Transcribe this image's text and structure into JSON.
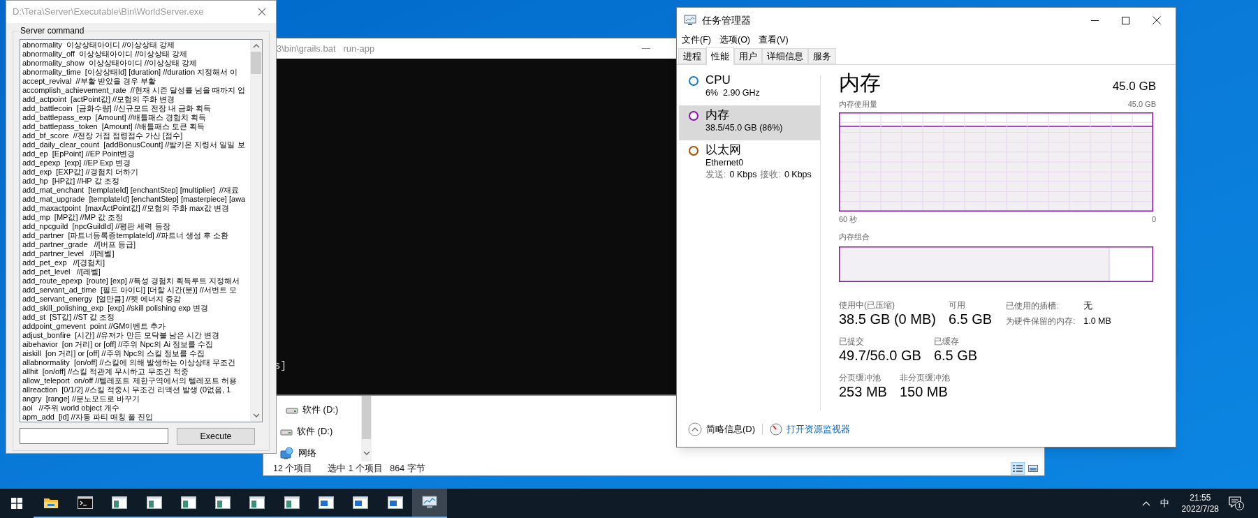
{
  "server_window": {
    "title": "D:\\Tera\\Server\\Executable\\Bin\\WorldServer.exe",
    "group_label": "Server command",
    "commands": [
      "abnormality  이상상태아이디 //이상상태 강제",
      "abnormality_off  이상상태아이디 //이상상태 강제",
      "abnormality_show  이상상태아이디 //이상상태 강제",
      "abnormality_time  [이상상태Id] [duration] //duration 지정해서 이",
      "accept_revival  //부활 받았을 경우 부활",
      "accomplish_achievement_rate  //현재 시즌 달성률 넘을 때까지 업",
      "add_actpoint  [actPoint값] //모험의 주화 변경",
      "add_battlecoin  [금화수량] //신규모드 전장 내 금화 획득",
      "add_battlepass_exp  [Amount] //배틀패스 경험치 획득",
      "add_battlepass_token  [Amount] //배틀패스 토큰 획득",
      "add_bf_score  //전장 거점 점령점수 가산 [점수]",
      "add_daily_clear_count  [addBonusCount] //발키온 지령서 일일 보",
      "add_ep  [EpPoint] //EP Point변경",
      "add_epexp  [exp] //EP Exp 변경",
      "add_exp  [EXP값] //경험치 더하기",
      "add_hp  [HP값] //HP 값 조정",
      "add_mat_enchant  [templateId] [enchantStep] [multiplier]  //재료",
      "add_mat_upgrade  [templateId] [enchantStep] [masterpiece] [awa",
      "add_maxactpoint  [maxActPoint값] //모험의 주화 max값 변경",
      "add_mp  [MP값] //MP 값 조정",
      "add_npcguild  [npcGuildId] //평판 세력 등장",
      "add_partner  [파트너등록증templateId] //파트너 생성 후 소환",
      "add_partner_grade   //[버프 등급]",
      "add_partner_level   //[레벨]",
      "add_pet_exp   //[경험치]",
      "add_pet_level   //[레벨]",
      "add_route_epexp  [route] [exp] //특성 경험치 획득루트 지정해서",
      "add_servant_ad_time  [필드 아이디] [더할 시간(분)] //서번트 모",
      "add_servant_energy  [얼만큼] //펫 에너지 증감",
      "add_skill_polishing_exp  [exp] //skill polishing exp 변경",
      "add_st  [ST값] //ST 값 조정",
      "addpoint_gmevent  point //GM이벤트 추가",
      "adjust_bonfire  [시간] //유저가 만든 모닥불 남은 시간 변경",
      "aibehavior  [on 거리] or [off] //주위 Npc의 Ai 정보를 수집",
      "aiskill  [on 거리] or [off] //주위 Npc의 스킬 정보를 수집",
      "allabnormality  [on/off] //스킬에 의해 발생하는 이상상태 무조건",
      "allhit  [on/off] //스킬 적관계 무시하고 무조건 적중",
      "allow_teleport  on/off //텔레포트 제한구역에서의 텔레포트 허용",
      "allreaction  [0/1/2] //스킬 적중시 무조건 리액션 발생 (0없음, 1",
      "angry  [range] //분노모드로 바꾸기",
      "aoi   //주위 world object 개수",
      "apm_add  [id] //자동 파티 매칭 풀 진입"
    ],
    "execute_button": "Execute"
  },
  "console_window": {
    "title": "3\\bin\\grails.bat   run-app",
    "output_lines": [
      "s]"
    ]
  },
  "explorer_window": {
    "nav_items": [
      {
        "kind": "group",
        "children": [
          {
            "kind": "drive",
            "label": "软件 (D:)"
          }
        ]
      },
      {
        "kind": "drive",
        "label": "软件 (D:)"
      },
      {
        "kind": "network",
        "label": "网络"
      }
    ],
    "status_bar": {
      "item_count": "12 个项目",
      "selection": "选中 1 个项目",
      "size": "864 字节"
    },
    "view_buttons": [
      {
        "kind": "details",
        "selected": true
      },
      {
        "kind": "large-icons",
        "selected": false
      }
    ]
  },
  "task_manager": {
    "title": "任务管理器",
    "menu": [
      "文件(F)",
      "选项(O)",
      "查看(V)"
    ],
    "tabs": [
      {
        "label": "进程",
        "selected": false
      },
      {
        "label": "性能",
        "selected": true
      },
      {
        "label": "用户",
        "selected": false
      },
      {
        "label": "详细信息",
        "selected": false
      },
      {
        "label": "服务",
        "selected": false
      }
    ],
    "resources": [
      {
        "name": "CPU",
        "detail": "6%  2.90 GHz",
        "color": "#1b7ac4",
        "selected": false
      },
      {
        "name": "内存",
        "detail": "38.5/45.0 GB (86%)",
        "color": "#8b12ae",
        "selected": true
      },
      {
        "name": "以太网",
        "detail": "Ethernet0",
        "throughput": [
          {
            "label": "发送:",
            "value": "0 Kbps"
          },
          {
            "label": "接收:",
            "value": "0 Kbps"
          }
        ],
        "color": "#a74f01",
        "selected": false
      }
    ],
    "heading": "内存",
    "capacity": "45.0 GB",
    "usage_chart": {
      "title": "内存使用量",
      "max_label": "45.0 GB",
      "x_start_label": "60 秒",
      "x_end_label": "0"
    },
    "composition": {
      "title": "内存组合",
      "level": 0.86
    },
    "stat_rows": [
      [
        {
          "label": "使用中(已压缩)",
          "value": "38.5 GB (0 MB)"
        },
        {
          "label": "可用",
          "value": "6.5 GB"
        }
      ],
      [
        {
          "label": "已提交",
          "value": "49.7/56.0 GB"
        },
        {
          "label": "已缓存",
          "value": "6.5 GB"
        }
      ],
      [
        {
          "label": "分页缓冲池",
          "value": "253 MB"
        },
        {
          "label": "非分页缓冲池",
          "value": "150 MB"
        }
      ]
    ],
    "hardware_info": [
      {
        "label": "已使用的插槽:",
        "value": "无"
      },
      {
        "label": "为硬件保留的内存:",
        "value": "1.0 MB"
      }
    ],
    "footer": {
      "details_toggle": "简略信息(D)",
      "monitor_link": "打开资源监视器"
    }
  },
  "taskbar": {
    "apps": [
      {
        "kind": "folder",
        "running": true,
        "active": false
      },
      {
        "kind": "terminal",
        "running": true,
        "active": false
      },
      {
        "kind": "window",
        "running": true,
        "active": false
      },
      {
        "kind": "window",
        "running": true,
        "active": false
      },
      {
        "kind": "window",
        "running": true,
        "active": false
      },
      {
        "kind": "window",
        "running": true,
        "active": false
      },
      {
        "kind": "window",
        "running": true,
        "active": false
      },
      {
        "kind": "window",
        "running": true,
        "active": false
      },
      {
        "kind": "blue-window",
        "running": true,
        "active": false
      },
      {
        "kind": "blue-window",
        "running": true,
        "active": false
      },
      {
        "kind": "blue-window",
        "running": true,
        "active": false
      },
      {
        "kind": "monitor",
        "running": true,
        "active": true
      }
    ],
    "tray": {
      "input_method": "中",
      "time": "21:55",
      "date": "2022/7/28",
      "notification_count": "1"
    }
  }
}
